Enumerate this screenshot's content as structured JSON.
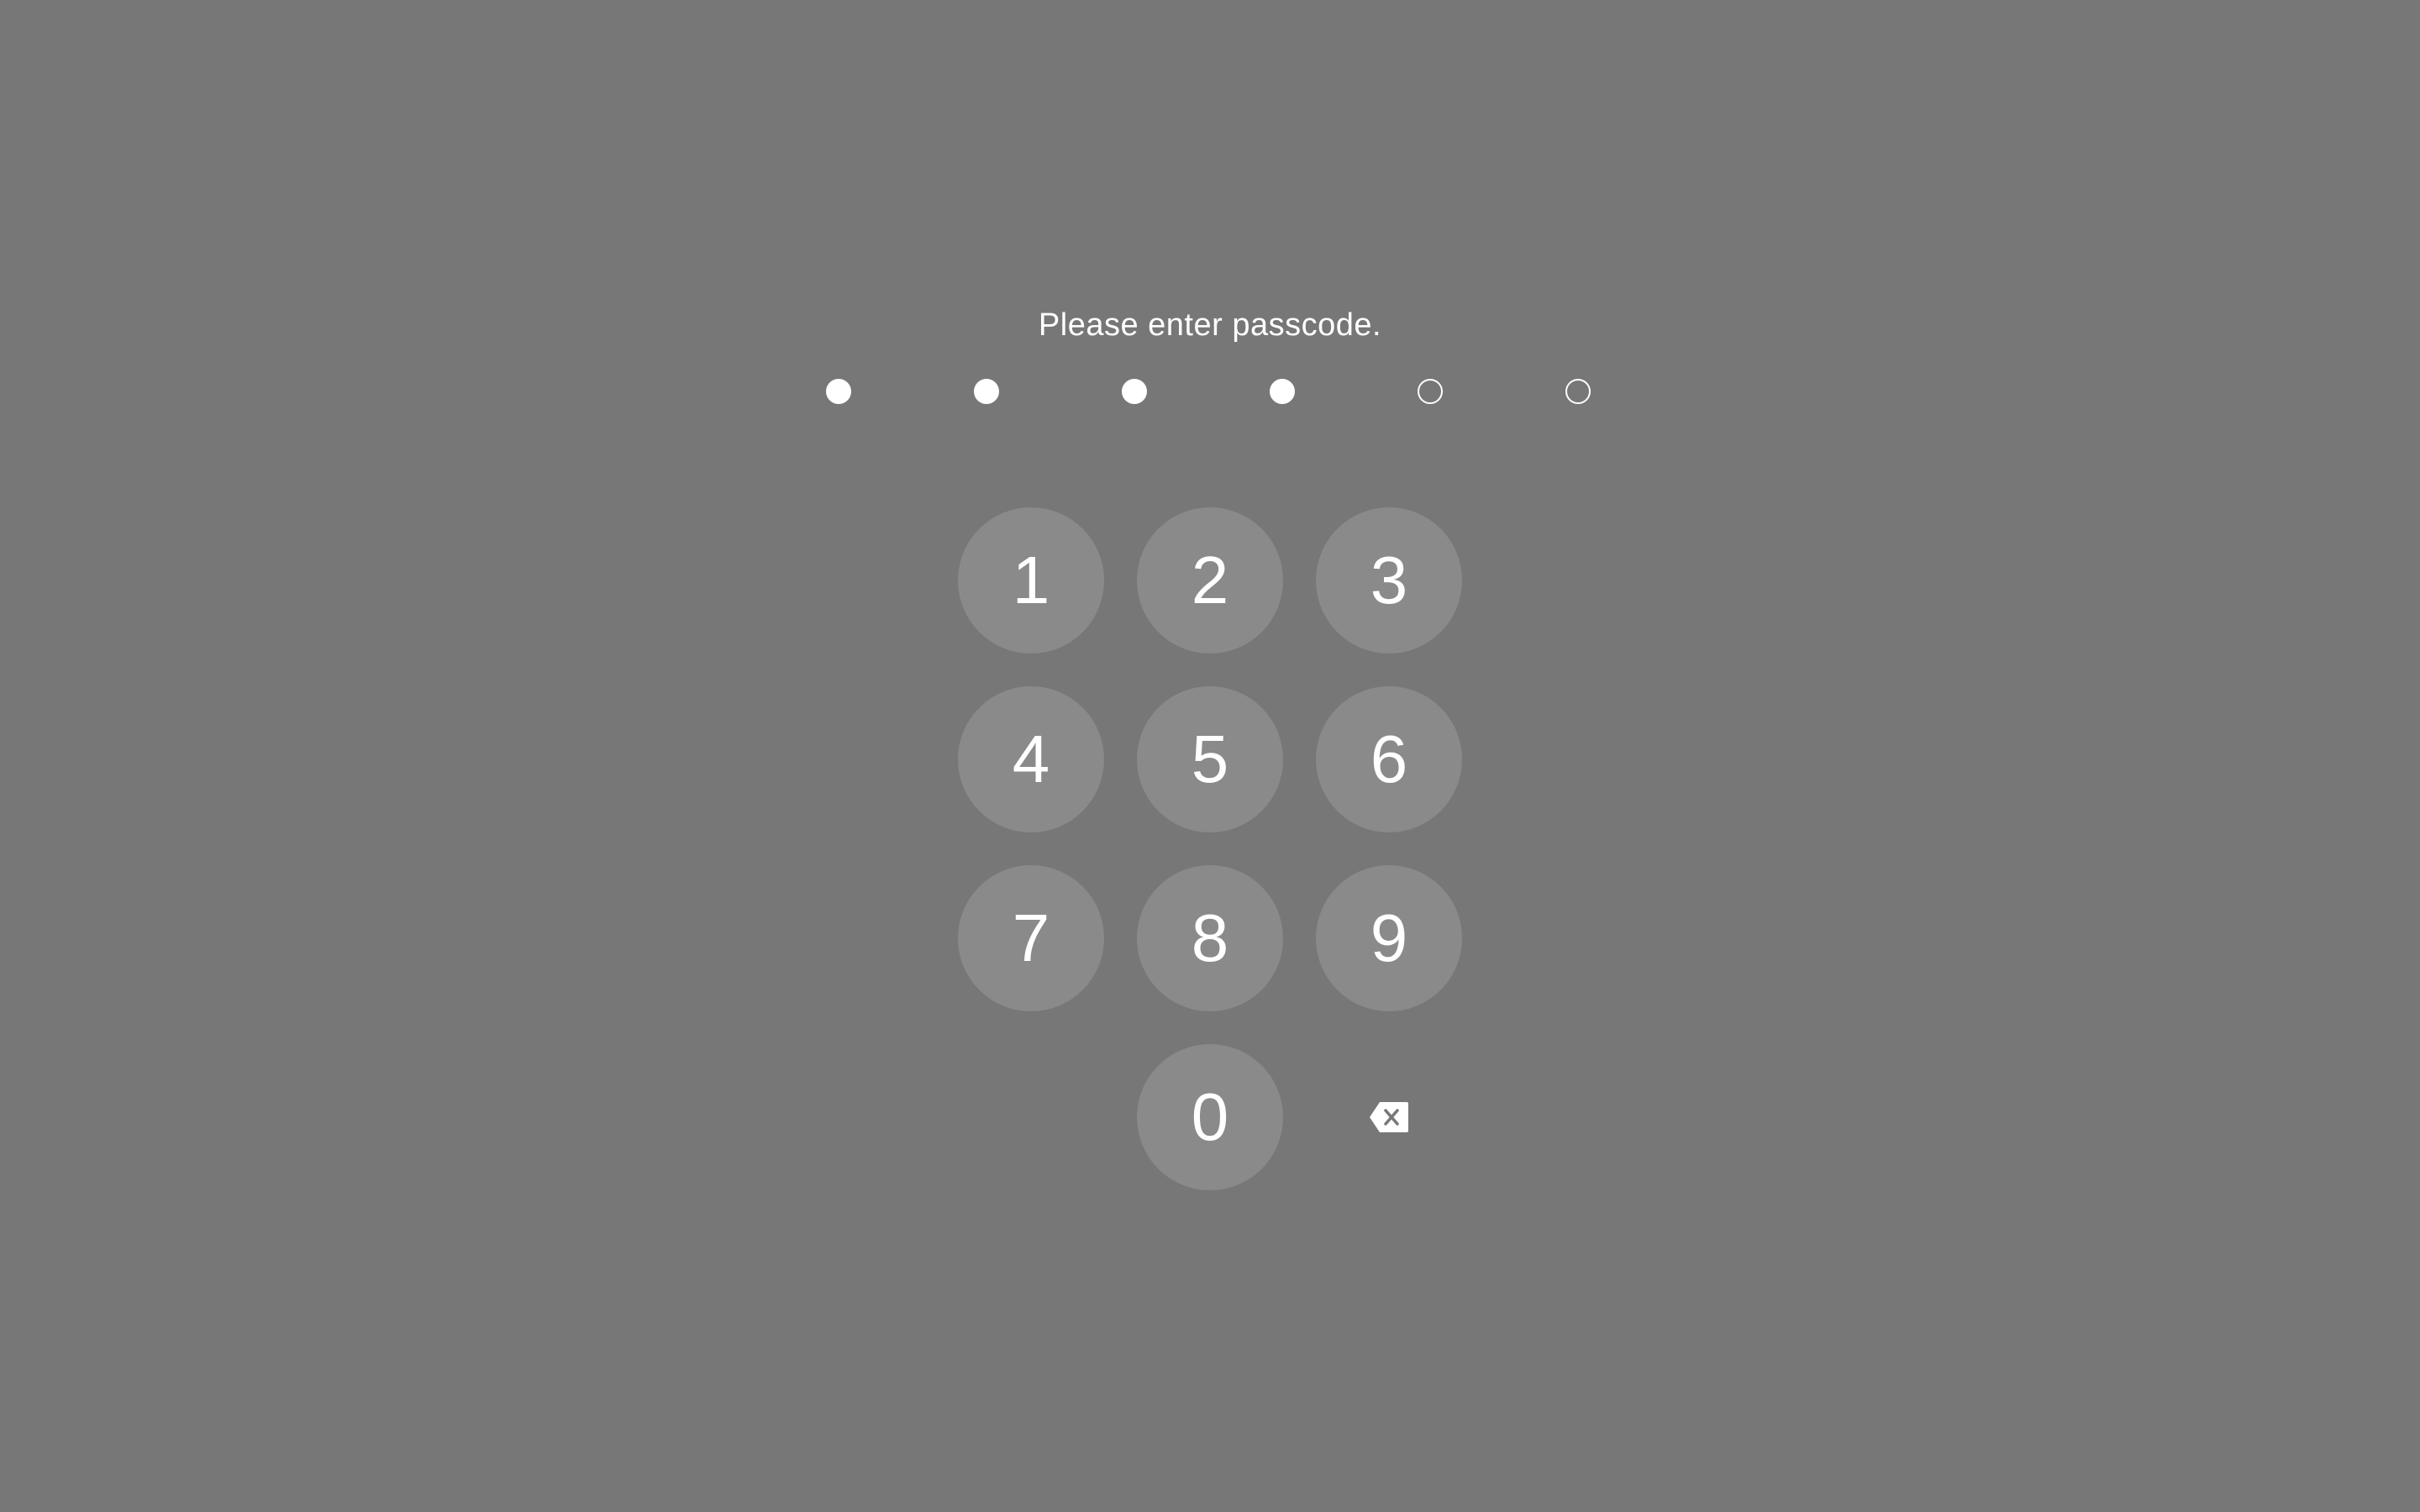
{
  "prompt": {
    "text": "Please enter passcode."
  },
  "passcode": {
    "length": 6,
    "entered": 4
  },
  "keypad": {
    "keys": [
      "1",
      "2",
      "3",
      "4",
      "5",
      "6",
      "7",
      "8",
      "9",
      "0"
    ],
    "delete_icon": "delete-backspace-icon"
  },
  "colors": {
    "background": "#777777",
    "key_background": "#8a8a8a",
    "foreground": "#ffffff"
  }
}
